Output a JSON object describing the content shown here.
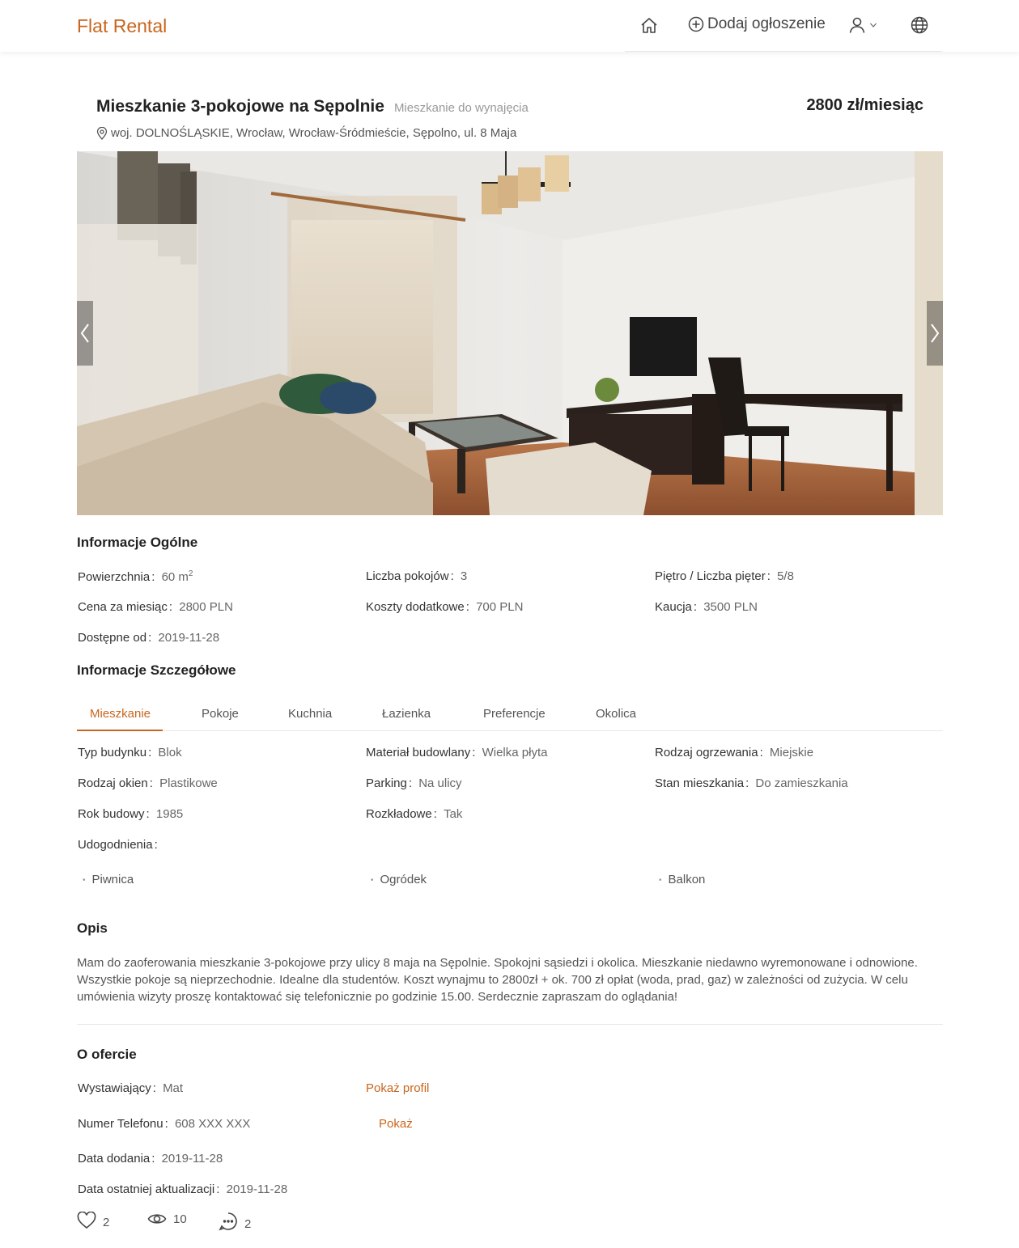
{
  "header": {
    "logo": "Flat Rental",
    "add_listing": "Dodaj ogłoszenie"
  },
  "listing": {
    "title": "Mieszkanie 3-pokojowe na Sępolnie",
    "category": "Mieszkanie do wynajęcia",
    "price": "2800 zł/miesiąc",
    "address": "woj. DOLNOŚLĄSKIE, Wrocław, Wrocław-Śródmieście, Sępolno, ul. 8 Maja"
  },
  "general": {
    "title": "Informacje Ogólne",
    "fields": [
      {
        "label": "Powierzchnia",
        "value": "60 m",
        "sup": "2"
      },
      {
        "label": "Liczba pokojów",
        "value": "3"
      },
      {
        "label": "Piętro / Liczba pięter",
        "value": "5/8"
      },
      {
        "label": "Cena za miesiąc",
        "value": "2800 PLN"
      },
      {
        "label": "Koszty dodatkowe",
        "value": "700 PLN"
      },
      {
        "label": "Kaucja",
        "value": "3500 PLN"
      },
      {
        "label": "Dostępne od",
        "value": "2019-11-28"
      }
    ]
  },
  "details": {
    "title": "Informacje Szczegółowe",
    "tabs": [
      "Mieszkanie",
      "Pokoje",
      "Kuchnia",
      "Łazienka",
      "Preferencje",
      "Okolica"
    ],
    "active_tab": "Mieszkanie",
    "fields": [
      {
        "label": "Typ budynku",
        "value": "Blok"
      },
      {
        "label": "Materiał budowlany",
        "value": "Wielka płyta"
      },
      {
        "label": "Rodzaj ogrzewania",
        "value": "Miejskie"
      },
      {
        "label": "Rodzaj okien",
        "value": "Plastikowe"
      },
      {
        "label": "Parking",
        "value": "Na ulicy"
      },
      {
        "label": "Stan mieszkania",
        "value": "Do zamieszkania"
      },
      {
        "label": "Rok budowy",
        "value": "1985"
      },
      {
        "label": "Rozkładowe",
        "value": "Tak"
      },
      {
        "label": "Udogodnienia",
        "value": ""
      }
    ],
    "amenities": [
      "Piwnica",
      "Ogródek",
      "Balkon"
    ]
  },
  "description": {
    "title": "Opis",
    "text": "Mam do zaoferowania mieszkanie 3-pokojowe przy ulicy 8 maja na Sępolnie. Spokojni sąsiedzi i okolica. Mieszkanie niedawno wyremonowane i odnowione. Wszystkie pokoje są nieprzechodnie. Idealne dla studentów. Koszt wynajmu to 2800zł + ok. 700 zł opłat (woda, prad, gaz) w zależności od zużycia. W celu umówienia wizyty proszę kontaktować się telefonicznie po godzinie 15.00. Serdecznie zapraszam do oglądania!"
  },
  "offer": {
    "title": "O ofercie",
    "fields": [
      {
        "label": "Wystawiający",
        "value": "Mat"
      },
      {
        "label": "Numer Telefonu",
        "value": "608 XXX XXX"
      },
      {
        "label": "Data dodania",
        "value": "2019-11-28"
      },
      {
        "label": "Data ostatniej aktualizacji",
        "value": "2019-11-28"
      }
    ],
    "show_profile": "Pokaż profil",
    "show_phone": "Pokaż"
  },
  "stats": {
    "likes": "2",
    "views": "10",
    "comments": "2"
  },
  "colors": {
    "accent": "#c9651c"
  }
}
